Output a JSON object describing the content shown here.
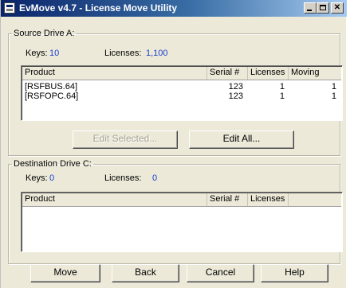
{
  "window": {
    "title": "EvMove v4.7 - License Move Utility"
  },
  "source": {
    "group_label": "Source Drive A:",
    "keys_label": "Keys:",
    "keys_value": "10",
    "licenses_label": "Licenses:",
    "licenses_value": "1,100",
    "columns": [
      "Product",
      "Serial #",
      "Licenses",
      "Moving"
    ],
    "rows": [
      {
        "product": "[RSFBUS.64]",
        "serial": "123",
        "licenses": "1",
        "moving": "1"
      },
      {
        "product": "[RSFOPC.64]",
        "serial": "123",
        "licenses": "1",
        "moving": "1"
      }
    ],
    "edit_selected_label": "Edit Selected...",
    "edit_all_label": "Edit All..."
  },
  "destination": {
    "group_label": "Destination Drive C:",
    "keys_label": "Keys:",
    "keys_value": "0",
    "licenses_label": "Licenses:",
    "licenses_value": "0",
    "columns": [
      "Product",
      "Serial #",
      "Licenses"
    ]
  },
  "footer": {
    "move_label": "Move",
    "back_label": "Back",
    "cancel_label": "Cancel",
    "help_label": "Help"
  },
  "colors": {
    "value_text": "#1a3fd0",
    "titlebar": "#0a246a"
  }
}
